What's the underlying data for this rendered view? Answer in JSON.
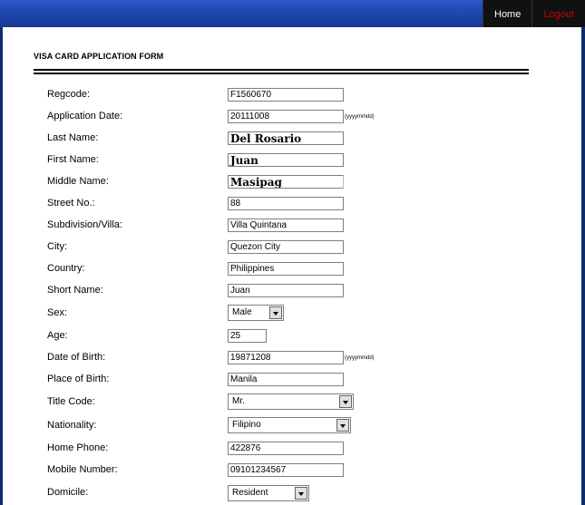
{
  "nav": {
    "home": "Home",
    "logout": "Logout"
  },
  "form": {
    "title": "VISA CARD APPLICATION FORM",
    "date_hint": "(yyyymmdd)",
    "fields": {
      "regcode": {
        "label": "Regcode:",
        "value": "F1560670"
      },
      "application_date": {
        "label": "Application Date:",
        "value": "20111008"
      },
      "last_name": {
        "label": "Last Name:",
        "value": "Del Rosario"
      },
      "first_name": {
        "label": "First Name:",
        "value": "Juan"
      },
      "middle_name": {
        "label": "Middle Name:",
        "value": "Masipag"
      },
      "street_no": {
        "label": "Street No.:",
        "value": "88"
      },
      "subdivision": {
        "label": "Subdivision/Villa:",
        "value": "Villa Quintana"
      },
      "city": {
        "label": "City:",
        "value": "Quezon City"
      },
      "country": {
        "label": "Country:",
        "value": "Philippines"
      },
      "short_name": {
        "label": "Short Name:",
        "value": "Juan"
      },
      "sex": {
        "label": "Sex:",
        "value": "Male"
      },
      "age": {
        "label": "Age:",
        "value": "25"
      },
      "date_of_birth": {
        "label": "Date of Birth:",
        "value": "19871208"
      },
      "place_of_birth": {
        "label": "Place of Birth:",
        "value": "Manila"
      },
      "title_code": {
        "label": "Title Code:",
        "value": "Mr."
      },
      "nationality": {
        "label": "Nationality:",
        "value": "Filipino"
      },
      "home_phone": {
        "label": "Home Phone:",
        "value": "422876"
      },
      "mobile_number": {
        "label": "Mobile Number:",
        "value": "09101234567"
      },
      "domicile": {
        "label": "Domicile:",
        "value": "Resident"
      }
    }
  }
}
